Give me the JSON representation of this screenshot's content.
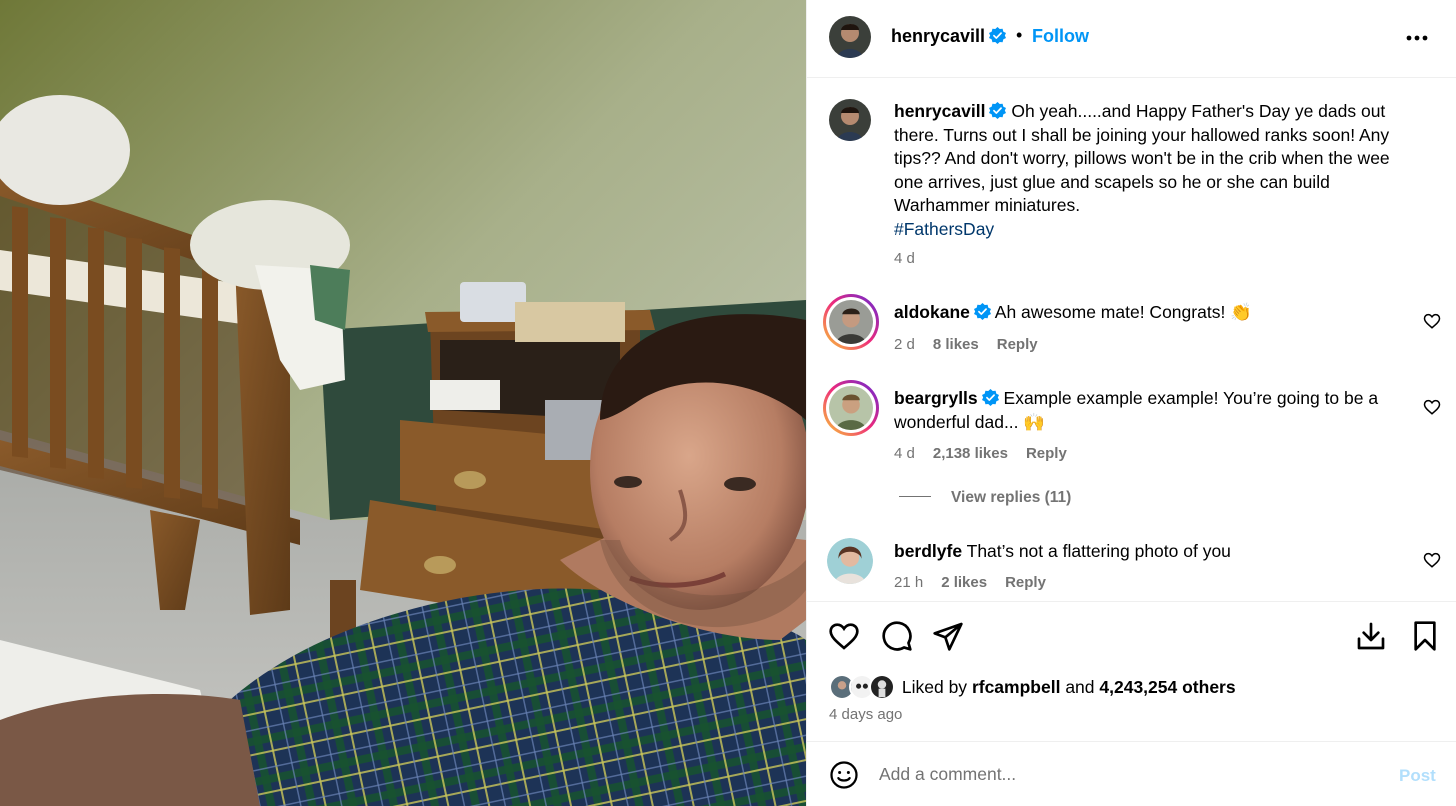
{
  "header": {
    "username": "henrycavill",
    "separator": "•",
    "follow_label": "Follow",
    "more_icon": "more-horizontal-icon"
  },
  "caption": {
    "username": "henrycavill",
    "text": "Oh yeah.....and Happy Father's Day ye dads out there. Turns out I shall be joining your hallowed ranks soon! Any tips?? And don't worry, pillows won't be in the crib when the wee one arrives, just glue and scapels so he or she can build Warhammer miniatures.",
    "hashtag": "#FathersDay",
    "time": "4 d"
  },
  "comments": [
    {
      "username": "aldokane",
      "verified": true,
      "text": "Ah awesome mate! Congrats! 👏",
      "time": "2 d",
      "likes": "8 likes",
      "reply": "Reply"
    },
    {
      "username": "beargrylls",
      "verified": true,
      "text": "Example example example! You’re going to be a wonderful dad... 🙌",
      "time": "4 d",
      "likes": "2,138 likes",
      "reply": "Reply"
    },
    {
      "username": "berdlyfe",
      "verified": false,
      "text": "That’s not a flattering photo of you",
      "time": "21 h",
      "likes": "2 likes",
      "reply": "Reply"
    }
  ],
  "view_replies": "View replies (11)",
  "actions": {
    "like_icon": "heart-icon",
    "comment_icon": "comment-icon",
    "share_icon": "send-icon",
    "download_icon": "download-icon",
    "save_icon": "bookmark-icon"
  },
  "likes": {
    "prefix": "Liked by",
    "user": "rfcampbell",
    "and": "and",
    "others": "4,243,254 others"
  },
  "post_time": "4 days ago",
  "add_comment": {
    "placeholder": "Add a comment...",
    "post_label": "Post"
  },
  "colors": {
    "accent": "#0095f6",
    "hashtag": "#00376b",
    "muted": "#737373",
    "post_disabled": "#b2dffc"
  }
}
